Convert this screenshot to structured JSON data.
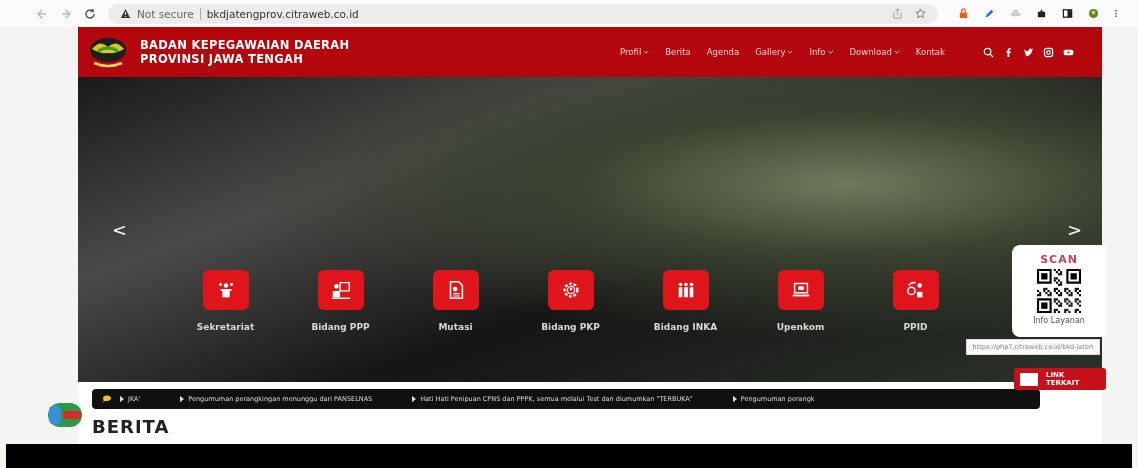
{
  "browser": {
    "security": "Not secure",
    "url": "bkdjatengprov.citraweb.co.id"
  },
  "header": {
    "title_lines": [
      "BADAN KEPEGAWAIAN DAERAH",
      "PROVINSI JAWA TENGAH"
    ],
    "nav": [
      {
        "label": "Profil",
        "dropdown": true
      },
      {
        "label": "Berita",
        "dropdown": false
      },
      {
        "label": "Agenda",
        "dropdown": false
      },
      {
        "label": "Gallery",
        "dropdown": true
      },
      {
        "label": "Info",
        "dropdown": true
      },
      {
        "label": "Download",
        "dropdown": true
      },
      {
        "label": "Kontak",
        "dropdown": false
      }
    ]
  },
  "hero": {
    "prev": "<",
    "next": ">",
    "services": [
      {
        "label": "Sekretariat",
        "kind": "person"
      },
      {
        "label": "Bidang PPP",
        "kind": "presentation"
      },
      {
        "label": "Mutasi",
        "kind": "document"
      },
      {
        "label": "Bidang PKP",
        "kind": "gear"
      },
      {
        "label": "Bidang INKA",
        "kind": "group"
      },
      {
        "label": "Upenkom",
        "kind": "laptop"
      },
      {
        "label": "PPID",
        "kind": "exchange"
      }
    ]
  },
  "scan_panel": {
    "title": "SCAN",
    "caption": "Info Layanan",
    "tooltip": "https://php7.citraweb.co.id/bkd-jaten"
  },
  "link_button": {
    "label": "LINK TERKAIT"
  },
  "ticker": {
    "items": [
      "JKA'",
      "Pengumuman perangkingan menunggu dari PANSELNAS",
      "Hati Hati Penipuan CPNS dan PPPK, semua melalui Test dan diumumkan \"TERBUKA\"",
      "Pengumuman perangk"
    ]
  },
  "news": {
    "heading": "BERITA"
  }
}
